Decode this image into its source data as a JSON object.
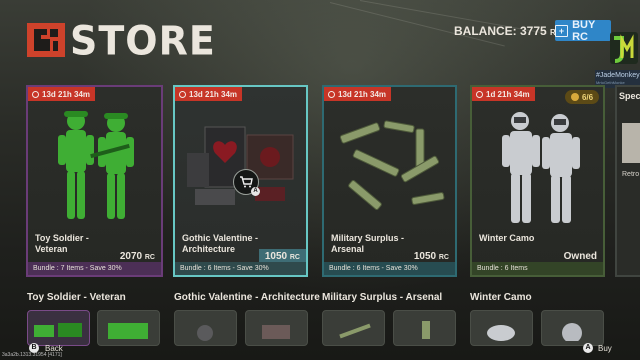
{
  "header": {
    "title": "STORE",
    "balance_label": "BALANCE: 3775",
    "balance_unit": "RC",
    "buy_button": "BUY RC"
  },
  "streamer": {
    "logo_letter": "JM",
    "name": "#JadeMonkey",
    "subtitle": "MrtoGethMonke"
  },
  "cards": [
    {
      "timer": "13d 21h 34m",
      "title_line1": "Toy Soldier -",
      "title_line2": "Veteran",
      "price": "2070",
      "unit": "RC",
      "bundle": "Bundle : 7 Items - Save 30%"
    },
    {
      "timer": "13d 21h 34m",
      "title_line1": "Gothic Valentine -",
      "title_line2": "Architecture",
      "price": "1050",
      "unit": "RC",
      "bundle": "Bundle : 6 Items - Save 30%"
    },
    {
      "timer": "13d 21h 34m",
      "title_line1": "Military Surplus -",
      "title_line2": "Arsenal",
      "price": "1050",
      "unit": "RC",
      "bundle": "Bundle : 6 Items - Save 30%"
    },
    {
      "timer": "1d 21h 34m",
      "title_line1": "Winter Camo",
      "title_line2": "",
      "status": "Owned",
      "items_badge": "6/6",
      "bundle": "Bundle : 6 Items"
    }
  ],
  "partial_card": {
    "title": "Speci",
    "item": "Retro"
  },
  "sections": [
    "Toy Soldier - Veteran",
    "Gothic Valentine - Architecture",
    "Military Surplus - Arsenal",
    "Winter Camo"
  ],
  "footer": {
    "back_key": "B",
    "back_label": "Back",
    "buy_key": "A",
    "buy_label": "Buy",
    "build": "3a3a2b.1313.31954 [4171]"
  },
  "colors": {
    "accent_red": "#c73527",
    "buy_blue": "#2f86c8",
    "brand_red": "#ce422b"
  }
}
